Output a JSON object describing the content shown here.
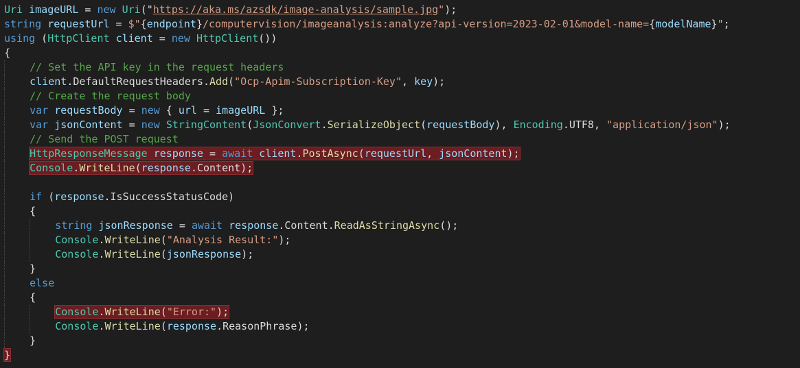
{
  "editor": {
    "language": "C#",
    "colors": {
      "background": "#1e1e1e",
      "keyword": "#569cd6",
      "type": "#4ec9b0",
      "string": "#d69d85",
      "comment": "#57a64a",
      "method": "#dcdcaa",
      "variable": "#9cdcfe",
      "default": "#dcdcdc",
      "highlight": "#6b1d21"
    },
    "lines": [
      {
        "indent": 0,
        "highlight": false,
        "tokens": [
          {
            "t": "Uri",
            "k": "type"
          },
          {
            "t": " ",
            "k": "default"
          },
          {
            "t": "imageURL",
            "k": "variable"
          },
          {
            "t": " = ",
            "k": "default"
          },
          {
            "t": "new",
            "k": "keyword"
          },
          {
            "t": " ",
            "k": "default"
          },
          {
            "t": "Uri",
            "k": "type"
          },
          {
            "t": "(\"",
            "k": "default"
          },
          {
            "t": "https://aka.ms/azsdk/image-analysis/sample.jpg",
            "k": "url"
          },
          {
            "t": "\"",
            "k": "string"
          },
          {
            "t": ");",
            "k": "default"
          }
        ]
      },
      {
        "indent": 0,
        "highlight": false,
        "tokens": [
          {
            "t": "string",
            "k": "keyword"
          },
          {
            "t": " ",
            "k": "default"
          },
          {
            "t": "requestUrl",
            "k": "variable"
          },
          {
            "t": " = ",
            "k": "default"
          },
          {
            "t": "$\"",
            "k": "string"
          },
          {
            "t": "{",
            "k": "default"
          },
          {
            "t": "endpoint",
            "k": "variable"
          },
          {
            "t": "}",
            "k": "default"
          },
          {
            "t": "/computervision/imageanalysis:analyze?api-version=2023-02-01&model-name=",
            "k": "string"
          },
          {
            "t": "{",
            "k": "default"
          },
          {
            "t": "modelName",
            "k": "variable"
          },
          {
            "t": "}",
            "k": "default"
          },
          {
            "t": "\"",
            "k": "string"
          },
          {
            "t": ";",
            "k": "default"
          }
        ]
      },
      {
        "indent": 0,
        "highlight": false,
        "tokens": [
          {
            "t": "using",
            "k": "keyword"
          },
          {
            "t": " (",
            "k": "default"
          },
          {
            "t": "HttpClient",
            "k": "type"
          },
          {
            "t": " ",
            "k": "default"
          },
          {
            "t": "client",
            "k": "variable"
          },
          {
            "t": " = ",
            "k": "default"
          },
          {
            "t": "new",
            "k": "keyword"
          },
          {
            "t": " ",
            "k": "default"
          },
          {
            "t": "HttpClient",
            "k": "type"
          },
          {
            "t": "())",
            "k": "default"
          }
        ]
      },
      {
        "indent": 0,
        "highlight": false,
        "tokens": [
          {
            "t": "{",
            "k": "default"
          }
        ]
      },
      {
        "indent": 1,
        "highlight": false,
        "tokens": [
          {
            "t": "// Set the API key in the request headers",
            "k": "comment"
          }
        ]
      },
      {
        "indent": 1,
        "highlight": false,
        "tokens": [
          {
            "t": "client",
            "k": "variable"
          },
          {
            "t": ".",
            "k": "default"
          },
          {
            "t": "DefaultRequestHeaders",
            "k": "default"
          },
          {
            "t": ".",
            "k": "default"
          },
          {
            "t": "Add",
            "k": "method"
          },
          {
            "t": "(",
            "k": "default"
          },
          {
            "t": "\"Ocp-Apim-Subscription-Key\"",
            "k": "string"
          },
          {
            "t": ", ",
            "k": "default"
          },
          {
            "t": "key",
            "k": "variable"
          },
          {
            "t": ");",
            "k": "default"
          }
        ]
      },
      {
        "indent": 1,
        "highlight": false,
        "tokens": [
          {
            "t": "// Create the request body",
            "k": "comment"
          }
        ]
      },
      {
        "indent": 1,
        "highlight": false,
        "tokens": [
          {
            "t": "var",
            "k": "keyword"
          },
          {
            "t": " ",
            "k": "default"
          },
          {
            "t": "requestBody",
            "k": "variable"
          },
          {
            "t": " = ",
            "k": "default"
          },
          {
            "t": "new",
            "k": "keyword"
          },
          {
            "t": " { ",
            "k": "default"
          },
          {
            "t": "url",
            "k": "variable"
          },
          {
            "t": " = ",
            "k": "default"
          },
          {
            "t": "imageURL",
            "k": "variable"
          },
          {
            "t": " };",
            "k": "default"
          }
        ]
      },
      {
        "indent": 1,
        "highlight": false,
        "tokens": [
          {
            "t": "var",
            "k": "keyword"
          },
          {
            "t": " ",
            "k": "default"
          },
          {
            "t": "jsonContent",
            "k": "variable"
          },
          {
            "t": " = ",
            "k": "default"
          },
          {
            "t": "new",
            "k": "keyword"
          },
          {
            "t": " ",
            "k": "default"
          },
          {
            "t": "StringContent",
            "k": "type"
          },
          {
            "t": "(",
            "k": "default"
          },
          {
            "t": "JsonConvert",
            "k": "type"
          },
          {
            "t": ".",
            "k": "default"
          },
          {
            "t": "SerializeObject",
            "k": "method"
          },
          {
            "t": "(",
            "k": "default"
          },
          {
            "t": "requestBody",
            "k": "variable"
          },
          {
            "t": "), ",
            "k": "default"
          },
          {
            "t": "Encoding",
            "k": "type"
          },
          {
            "t": ".",
            "k": "default"
          },
          {
            "t": "UTF8",
            "k": "default"
          },
          {
            "t": ", ",
            "k": "default"
          },
          {
            "t": "\"application/json\"",
            "k": "string"
          },
          {
            "t": ");",
            "k": "default"
          }
        ]
      },
      {
        "indent": 1,
        "highlight": false,
        "tokens": [
          {
            "t": "// Send the POST request",
            "k": "comment"
          }
        ]
      },
      {
        "indent": 1,
        "highlight": true,
        "tokens": [
          {
            "t": "HttpResponseMessage",
            "k": "type"
          },
          {
            "t": " ",
            "k": "default"
          },
          {
            "t": "response",
            "k": "variable"
          },
          {
            "t": " = ",
            "k": "default"
          },
          {
            "t": "await",
            "k": "keyword"
          },
          {
            "t": " ",
            "k": "default"
          },
          {
            "t": "client",
            "k": "variable"
          },
          {
            "t": ".",
            "k": "default"
          },
          {
            "t": "PostAsync",
            "k": "method"
          },
          {
            "t": "(",
            "k": "default"
          },
          {
            "t": "requestUrl",
            "k": "variable"
          },
          {
            "t": ", ",
            "k": "default"
          },
          {
            "t": "jsonContent",
            "k": "variable"
          },
          {
            "t": ");",
            "k": "default"
          }
        ]
      },
      {
        "indent": 1,
        "highlight": true,
        "tokens": [
          {
            "t": "Console",
            "k": "type"
          },
          {
            "t": ".",
            "k": "default"
          },
          {
            "t": "WriteLine",
            "k": "method"
          },
          {
            "t": "(",
            "k": "default"
          },
          {
            "t": "response",
            "k": "variable"
          },
          {
            "t": ".",
            "k": "default"
          },
          {
            "t": "Content",
            "k": "default"
          },
          {
            "t": ");",
            "k": "default"
          }
        ]
      },
      {
        "indent": 1,
        "highlight": false,
        "tokens": []
      },
      {
        "indent": 1,
        "highlight": false,
        "tokens": [
          {
            "t": "if",
            "k": "keyword"
          },
          {
            "t": " (",
            "k": "default"
          },
          {
            "t": "response",
            "k": "variable"
          },
          {
            "t": ".",
            "k": "default"
          },
          {
            "t": "IsSuccessStatusCode",
            "k": "default"
          },
          {
            "t": ")",
            "k": "default"
          }
        ]
      },
      {
        "indent": 1,
        "highlight": false,
        "tokens": [
          {
            "t": "{",
            "k": "default"
          }
        ]
      },
      {
        "indent": 2,
        "highlight": false,
        "tokens": [
          {
            "t": "string",
            "k": "keyword"
          },
          {
            "t": " ",
            "k": "default"
          },
          {
            "t": "jsonResponse",
            "k": "variable"
          },
          {
            "t": " = ",
            "k": "default"
          },
          {
            "t": "await",
            "k": "keyword"
          },
          {
            "t": " ",
            "k": "default"
          },
          {
            "t": "response",
            "k": "variable"
          },
          {
            "t": ".",
            "k": "default"
          },
          {
            "t": "Content",
            "k": "default"
          },
          {
            "t": ".",
            "k": "default"
          },
          {
            "t": "ReadAsStringAsync",
            "k": "method"
          },
          {
            "t": "();",
            "k": "default"
          }
        ]
      },
      {
        "indent": 2,
        "highlight": false,
        "tokens": [
          {
            "t": "Console",
            "k": "type"
          },
          {
            "t": ".",
            "k": "default"
          },
          {
            "t": "WriteLine",
            "k": "method"
          },
          {
            "t": "(",
            "k": "default"
          },
          {
            "t": "\"Analysis Result:\"",
            "k": "string"
          },
          {
            "t": ");",
            "k": "default"
          }
        ]
      },
      {
        "indent": 2,
        "highlight": false,
        "tokens": [
          {
            "t": "Console",
            "k": "type"
          },
          {
            "t": ".",
            "k": "default"
          },
          {
            "t": "WriteLine",
            "k": "method"
          },
          {
            "t": "(",
            "k": "default"
          },
          {
            "t": "jsonResponse",
            "k": "variable"
          },
          {
            "t": ");",
            "k": "default"
          }
        ]
      },
      {
        "indent": 1,
        "highlight": false,
        "tokens": [
          {
            "t": "}",
            "k": "default"
          }
        ]
      },
      {
        "indent": 1,
        "highlight": false,
        "tokens": [
          {
            "t": "else",
            "k": "keyword"
          }
        ]
      },
      {
        "indent": 1,
        "highlight": false,
        "tokens": [
          {
            "t": "{",
            "k": "default"
          }
        ]
      },
      {
        "indent": 2,
        "highlight": true,
        "tokens": [
          {
            "t": "Console",
            "k": "type"
          },
          {
            "t": ".",
            "k": "default"
          },
          {
            "t": "WriteLine",
            "k": "method"
          },
          {
            "t": "(",
            "k": "default"
          },
          {
            "t": "\"Error:\"",
            "k": "string"
          },
          {
            "t": ");",
            "k": "default"
          }
        ]
      },
      {
        "indent": 2,
        "highlight": false,
        "tokens": [
          {
            "t": "Console",
            "k": "type"
          },
          {
            "t": ".",
            "k": "default"
          },
          {
            "t": "WriteLine",
            "k": "method"
          },
          {
            "t": "(",
            "k": "default"
          },
          {
            "t": "response",
            "k": "variable"
          },
          {
            "t": ".",
            "k": "default"
          },
          {
            "t": "ReasonPhrase",
            "k": "default"
          },
          {
            "t": ");",
            "k": "default"
          }
        ]
      },
      {
        "indent": 1,
        "highlight": false,
        "tokens": [
          {
            "t": "}",
            "k": "default"
          }
        ]
      },
      {
        "indent": 0,
        "highlight": "brace",
        "tokens": [
          {
            "t": "}",
            "k": "default"
          }
        ]
      }
    ]
  }
}
